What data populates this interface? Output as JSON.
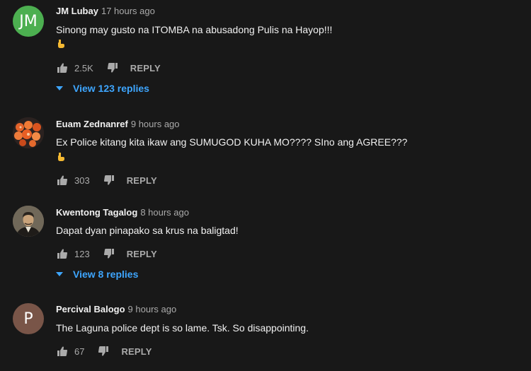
{
  "comments": [
    {
      "avatar_letter": "JM",
      "avatar_color": "#4caf50",
      "author": "JM Lubay",
      "time": "17 hours ago",
      "text": "Sinong may gusto na ITOMBA na abusadong Pulis na Hayop!!!",
      "emoji": "point-down-emoji",
      "likes": "2.5K",
      "reply_label": "REPLY",
      "view_replies": "View 123 replies"
    },
    {
      "avatar_image": "orange-food-photo",
      "author": "Euam Zednanref",
      "time": "9 hours ago",
      "text": "Ex Police kitang kita ikaw ang SUMUGOD KUHA MO???? SIno ang AGREE???",
      "emoji": "point-down-emoji",
      "likes": "303",
      "reply_label": "REPLY"
    },
    {
      "avatar_image": "portrait-painting",
      "author": "Kwentong Tagalog",
      "time": "8 hours ago",
      "text": "Dapat dyan pinapako sa krus na baligtad!",
      "likes": "123",
      "reply_label": "REPLY",
      "view_replies": "View 8 replies"
    },
    {
      "avatar_letter": "P",
      "avatar_color": "#795548",
      "author": "Percival Balogo",
      "time": "9 hours ago",
      "text": "The Laguna police dept is so lame.  Tsk. So disappointing.",
      "likes": "67",
      "reply_label": "REPLY"
    }
  ],
  "colors": {
    "background": "#181818",
    "link_blue": "#3ea6ff",
    "secondary_text": "#aaaaaa"
  }
}
